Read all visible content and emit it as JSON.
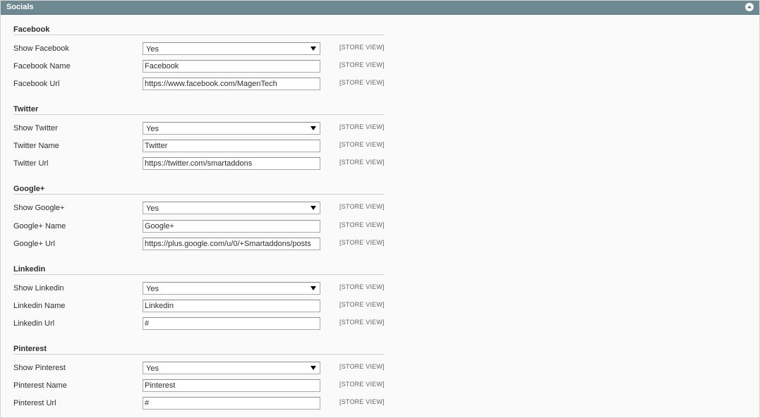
{
  "panel": {
    "title": "Socials"
  },
  "groups": [
    {
      "title": "Facebook",
      "rows": [
        {
          "label": "Show Facebook",
          "kind": "select",
          "value": "Yes",
          "scope": "[STORE VIEW]"
        },
        {
          "label": "Facebook Name",
          "kind": "input",
          "value": "Facebook",
          "scope": "[STORE VIEW]"
        },
        {
          "label": "Facebook Url",
          "kind": "input",
          "value": "https://www.facebook.com/MagenTech",
          "scope": "[STORE VIEW]"
        }
      ]
    },
    {
      "title": "Twitter",
      "rows": [
        {
          "label": "Show Twitter",
          "kind": "select",
          "value": "Yes",
          "scope": "[STORE VIEW]"
        },
        {
          "label": "Twitter Name",
          "kind": "input",
          "value": "Twitter",
          "scope": "[STORE VIEW]"
        },
        {
          "label": "Twitter Url",
          "kind": "input",
          "value": "https://twitter.com/smartaddons",
          "scope": "[STORE VIEW]"
        }
      ]
    },
    {
      "title": "Google+",
      "rows": [
        {
          "label": "Show Google+",
          "kind": "select",
          "value": "Yes",
          "scope": "[STORE VIEW]"
        },
        {
          "label": "Google+ Name",
          "kind": "input",
          "value": "Google+",
          "scope": "[STORE VIEW]"
        },
        {
          "label": "Google+ Url",
          "kind": "input",
          "value": "https://plus.google.com/u/0/+Smartaddons/posts",
          "scope": "[STORE VIEW]"
        }
      ]
    },
    {
      "title": "Linkedin",
      "rows": [
        {
          "label": "Show Linkedin",
          "kind": "select",
          "value": "Yes",
          "scope": "[STORE VIEW]"
        },
        {
          "label": "Linkedin Name",
          "kind": "input",
          "value": "Linkedin",
          "scope": "[STORE VIEW]"
        },
        {
          "label": "Linkedin Url",
          "kind": "input",
          "value": "#",
          "scope": "[STORE VIEW]"
        }
      ]
    },
    {
      "title": "Pinterest",
      "rows": [
        {
          "label": "Show Pinterest",
          "kind": "select",
          "value": "Yes",
          "scope": "[STORE VIEW]"
        },
        {
          "label": "Pinterest Name",
          "kind": "input",
          "value": "Pinterest",
          "scope": "[STORE VIEW]"
        },
        {
          "label": "Pinterest Url",
          "kind": "input",
          "value": "#",
          "scope": "[STORE VIEW]"
        }
      ]
    }
  ]
}
